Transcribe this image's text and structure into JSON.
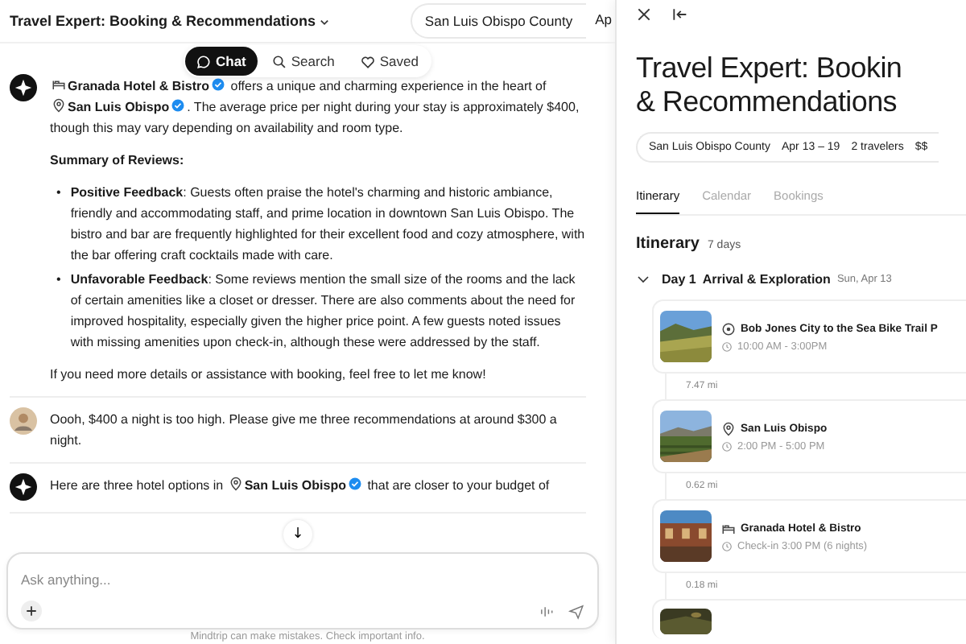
{
  "chat": {
    "title": "Travel Expert: Booking & Recommendations",
    "chips": [
      "San Luis Obispo County",
      "Ap"
    ],
    "modes": [
      {
        "label": "Chat",
        "kind": "chat",
        "selected": true
      },
      {
        "label": "Search",
        "kind": "search",
        "selected": false
      },
      {
        "label": "Saved",
        "kind": "saved",
        "selected": false
      }
    ],
    "messages": [
      {
        "kind": "assistant",
        "blocks": [
          {
            "kind": "parts",
            "parts": [
              {
                "kind": "hotel",
                "text": "Granada Hotel & Bistro"
              },
              {
                "kind": "text",
                "text": " offers a unique and charming experience in the heart of "
              },
              {
                "kind": "place",
                "text": "San Luis Obispo"
              },
              {
                "kind": "text",
                "text": ". The average price per night during your stay is approximately $400, though this may vary depending on availability and room type."
              }
            ]
          },
          {
            "kind": "heading",
            "text": "Summary of Reviews:"
          },
          {
            "kind": "bullets",
            "items": [
              {
                "marker": "•",
                "text": "**Positive Feedback**: Guests often praise the hotel's charming and historic ambiance, friendly and accommodating staff, and prime location in downtown San Luis Obispo. The bistro and bar are frequently highlighted for their excellent food and cozy atmosphere, with the bar offering craft cocktails made with care."
              },
              {
                "marker": "•",
                "text": "**Unfavorable Feedback**: Some reviews mention the small size of the rooms and the lack of certain amenities like a closet or dresser. There are also comments about the need for improved hospitality, especially given the higher price point. A few guests noted issues with missing amenities upon check-in, although these were addressed by the staff."
              }
            ]
          },
          {
            "kind": "text",
            "text": "If you need more details or assistance with booking, feel free to let me know!"
          }
        ]
      },
      {
        "kind": "user",
        "blocks": [
          {
            "kind": "text",
            "text": "Oooh, $400 a night is too high. Please give me three recommendations at around $300 a night."
          }
        ]
      },
      {
        "kind": "assistant",
        "blocks": [
          {
            "kind": "parts",
            "parts": [
              {
                "kind": "text",
                "text": "Here are three hotel options in "
              },
              {
                "kind": "place",
                "text": "San Luis Obispo"
              },
              {
                "kind": "text",
                "text": " that are closer to your budget of"
              }
            ]
          }
        ]
      }
    ],
    "scroll_down": "↓",
    "composer": {
      "placeholder": "Ask anything..."
    },
    "footer": "Mindtrip can make mistakes. Check important info."
  },
  "panel": {
    "title_lines": [
      "Travel Expert: Bookin",
      "& Recommendations"
    ],
    "chips": [
      "San Luis Obispo County",
      "Apr 13 – 19",
      "2 travelers",
      "$$"
    ],
    "tabs": [
      {
        "label": "Itinerary",
        "selected": true
      },
      {
        "label": "Calendar",
        "selected": false
      },
      {
        "label": "Bookings",
        "selected": false
      }
    ],
    "heading": "Itinerary",
    "days_count": "7 days",
    "day": {
      "label": "Day 1",
      "title": "Arrival & Exploration",
      "date": "Sun, Apr 13",
      "expanded": true,
      "stops": [
        {
          "kind": "activity",
          "title": "Bob Jones City to the Sea Bike Trail P",
          "time": "10:00 AM - 3:00PM",
          "distance": "7.47 mi"
        },
        {
          "kind": "place",
          "title": "San Luis Obispo",
          "time": "2:00 PM - 5:00 PM",
          "distance": "0.62 mi"
        },
        {
          "kind": "hotel",
          "title": "Granada Hotel & Bistro",
          "time": "Check-in 3:00 PM (6 nights)",
          "distance": "0.18 mi"
        },
        {
          "kind": "partial"
        }
      ]
    }
  }
}
